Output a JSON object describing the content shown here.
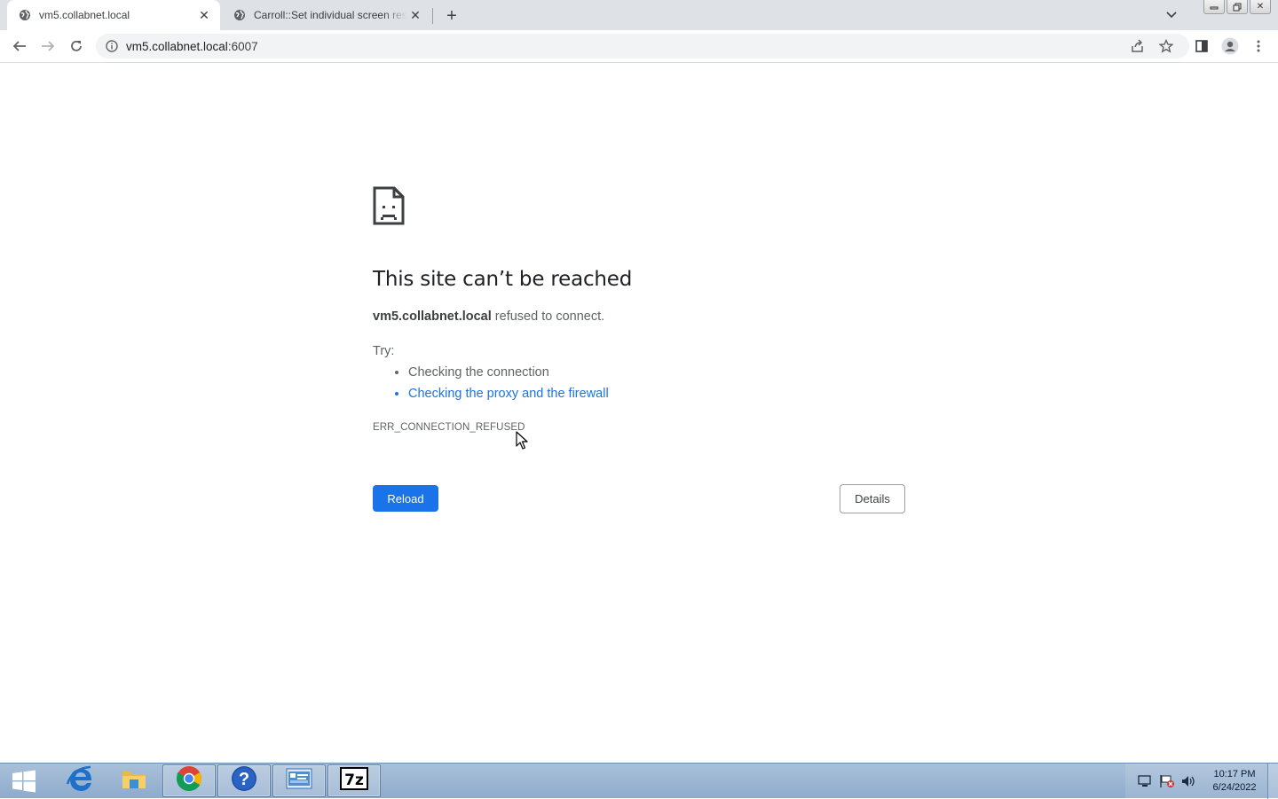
{
  "browser": {
    "tabs": [
      {
        "title": "vm5.collabnet.local",
        "active": true,
        "icon": "globe-icon"
      },
      {
        "title": "Carroll::Set individual screen reso",
        "active": false,
        "icon": "globe-icon"
      }
    ],
    "new_tab_label": "+",
    "address": {
      "host": "vm5.collabnet.local",
      "port": ":6007"
    }
  },
  "error_page": {
    "title": "This site can’t be reached",
    "host": "vm5.collabnet.local",
    "message": " refused to connect.",
    "try_label": "Try:",
    "suggestions": [
      {
        "text": "Checking the connection",
        "link": false
      },
      {
        "text": "Checking the proxy and the firewall",
        "link": true
      }
    ],
    "error_code": "ERR_CONNECTION_REFUSED",
    "reload_label": "Reload",
    "details_label": "Details"
  },
  "taskbar": {
    "apps": [
      {
        "name": "internet-explorer",
        "icon": "ie-icon"
      },
      {
        "name": "file-explorer",
        "icon": "folder-icon"
      },
      {
        "name": "chrome",
        "icon": "chrome-icon"
      },
      {
        "name": "help",
        "icon": "help-icon"
      },
      {
        "name": "control-panel",
        "icon": "control-panel-icon"
      },
      {
        "name": "7zip",
        "icon": "7zip-icon",
        "label": "7z"
      }
    ],
    "clock": {
      "time": "10:17 PM",
      "date": "6/24/2022"
    }
  },
  "colors": {
    "accent": "#1a73e8",
    "tab_strip": "#dee1e6",
    "taskbar": "#9fb8d4"
  }
}
